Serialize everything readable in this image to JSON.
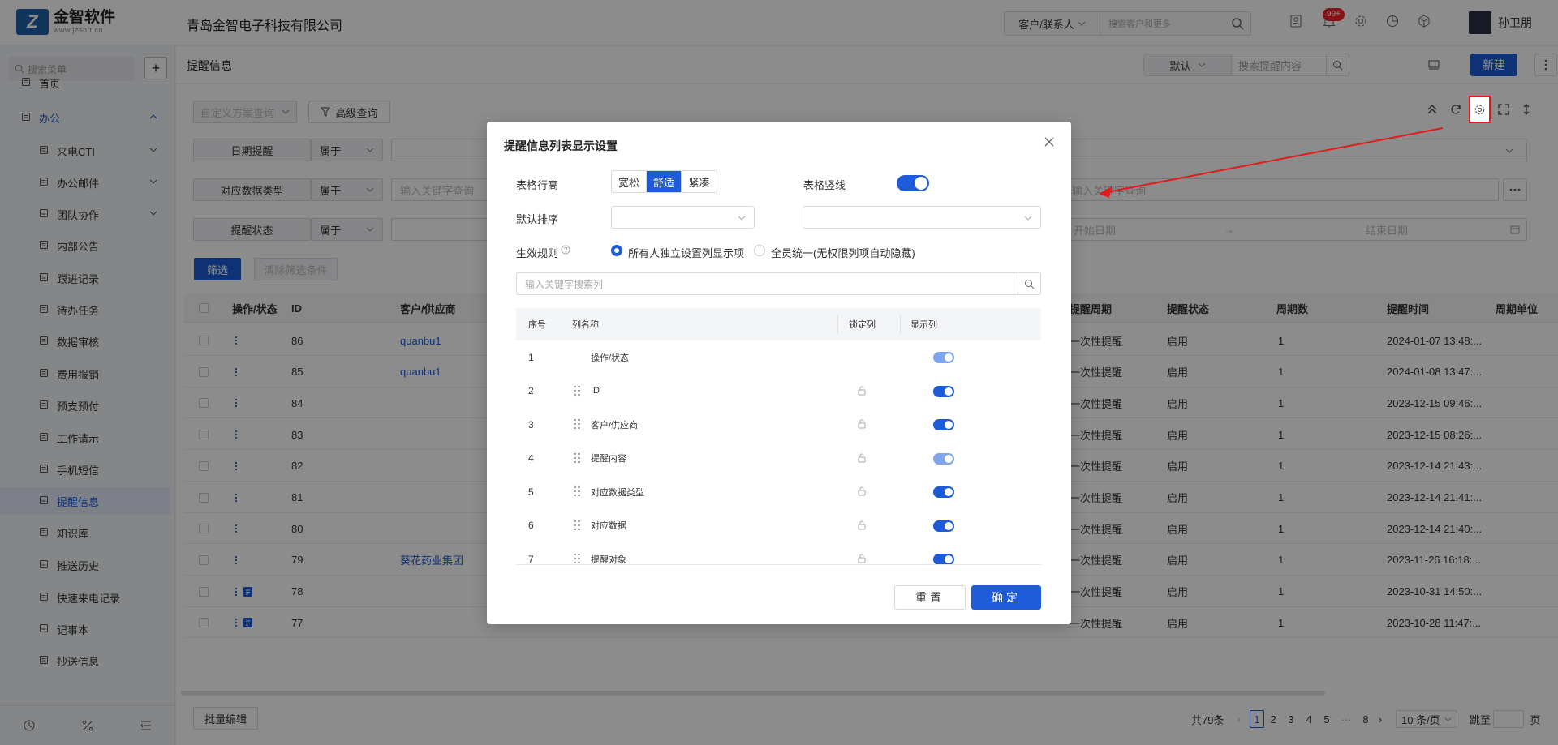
{
  "app": {
    "logo_text": "金智软件",
    "logo_url_text": "www.jzsoft.cn",
    "company": "青岛金智电子科技有限公司"
  },
  "header": {
    "search_scope": "客户/联系人",
    "search_placeholder": "搜索客户和更多",
    "notifications_badge": "99+",
    "user_name": "孙卫朋"
  },
  "sidebar": {
    "search_placeholder": "搜索菜单",
    "items": [
      {
        "label": "首页",
        "icon": "home-icon",
        "level": "top"
      },
      {
        "label": "办公",
        "icon": "office-icon",
        "level": "top",
        "expanded": true
      },
      {
        "label": "来电CTI",
        "icon": "copy-icon",
        "level": "sub",
        "has_children": true
      },
      {
        "label": "办公邮件",
        "icon": "copy-icon",
        "level": "sub",
        "has_children": true
      },
      {
        "label": "团队协作",
        "icon": "copy-icon",
        "level": "sub",
        "has_children": true
      },
      {
        "label": "内部公告",
        "icon": "speaker-icon",
        "level": "sub"
      },
      {
        "label": "跟进记录",
        "icon": "document-icon",
        "level": "sub"
      },
      {
        "label": "待办任务",
        "icon": "pin-icon",
        "level": "sub"
      },
      {
        "label": "数据审核",
        "icon": "user-icon",
        "level": "sub"
      },
      {
        "label": "费用报销",
        "icon": "receipt-icon",
        "level": "sub"
      },
      {
        "label": "预支预付",
        "icon": "card-icon",
        "level": "sub"
      },
      {
        "label": "工作请示",
        "icon": "form-icon",
        "level": "sub"
      },
      {
        "label": "手机短信",
        "icon": "chat-icon",
        "level": "sub"
      },
      {
        "label": "提醒信息",
        "icon": "bell-icon",
        "level": "sub",
        "active": true
      },
      {
        "label": "知识库",
        "icon": "book-icon",
        "level": "sub"
      },
      {
        "label": "推送历史",
        "icon": "clock-icon",
        "level": "sub"
      },
      {
        "label": "快速来电记录",
        "icon": "document-icon",
        "level": "sub"
      },
      {
        "label": "记事本",
        "icon": "notebook-icon",
        "level": "sub"
      },
      {
        "label": "抄送信息",
        "icon": "send-icon",
        "level": "sub"
      }
    ]
  },
  "page": {
    "title": "提醒信息",
    "scope_select": "默认",
    "search_placeholder": "搜索提醒内容",
    "new_button": "新建"
  },
  "filters": {
    "custom_scheme_placeholder": "自定义方案查询",
    "advanced_query": "高级查询",
    "rows": [
      {
        "field": "日期提醒",
        "op": "属于"
      },
      {
        "field": "对应数据类型",
        "op": "属于",
        "placeholder": "输入关键字查询"
      },
      {
        "field": "提醒状态",
        "op": "属于"
      }
    ],
    "right_keyword_placeholder": "输入关键字查询",
    "start_date": "开始日期",
    "range_arrow": "→",
    "end_date": "结束日期",
    "filter_button": "筛选",
    "clear_button": "清除筛选条件"
  },
  "table": {
    "headers_left": [
      "操作/状态",
      "ID",
      "客户/供应商"
    ],
    "headers_right": [
      "提醒周期",
      "提醒状态",
      "周期数",
      "提醒时间",
      "周期单位"
    ],
    "rows": [
      {
        "id": "86",
        "customer": "quanbu1",
        "period": "一次性提醒",
        "status": "启用",
        "count": "1",
        "time": "2024-01-07 13:48:...",
        "doc": false
      },
      {
        "id": "85",
        "customer": "quanbu1",
        "period": "一次性提醒",
        "status": "启用",
        "count": "1",
        "time": "2024-01-08 13:47:...",
        "doc": false
      },
      {
        "id": "84",
        "customer": "",
        "period": "一次性提醒",
        "status": "启用",
        "count": "1",
        "time": "2023-12-15 09:46:...",
        "doc": false
      },
      {
        "id": "83",
        "customer": "",
        "period": "一次性提醒",
        "status": "启用",
        "count": "1",
        "time": "2023-12-15 08:26:...",
        "doc": false
      },
      {
        "id": "82",
        "customer": "",
        "period": "一次性提醒",
        "status": "启用",
        "count": "1",
        "time": "2023-12-14 21:43:...",
        "doc": false
      },
      {
        "id": "81",
        "customer": "",
        "period": "一次性提醒",
        "status": "启用",
        "count": "1",
        "time": "2023-12-14 21:41:...",
        "doc": false
      },
      {
        "id": "80",
        "customer": "",
        "period": "一次性提醒",
        "status": "启用",
        "count": "1",
        "time": "2023-12-14 21:40:...",
        "doc": false
      },
      {
        "id": "79",
        "customer": "葵花药业集团",
        "period": "一次性提醒",
        "status": "启用",
        "count": "1",
        "time": "2023-11-26 16:18:...",
        "doc": false
      },
      {
        "id": "78",
        "customer": "",
        "period": "一次性提醒",
        "status": "启用",
        "count": "1",
        "time": "2023-10-31 14:50:...",
        "doc": true
      },
      {
        "id": "77",
        "customer": "",
        "period": "一次性提醒",
        "status": "启用",
        "count": "1",
        "time": "2023-10-28 11:47:...",
        "doc": true
      }
    ]
  },
  "footer": {
    "batch_edit": "批量编辑",
    "total": "共79条",
    "pages": [
      "1",
      "2",
      "3",
      "4",
      "5",
      "···",
      "8"
    ],
    "current_page": "1",
    "page_size": "10 条/页",
    "jump_label": "跳至",
    "page_unit": "页"
  },
  "modal": {
    "title": "提醒信息列表显示设置",
    "row_height_label": "表格行高",
    "row_height_options": [
      "宽松",
      "舒适",
      "紧凑"
    ],
    "row_height_selected": "舒适",
    "vertical_lines_label": "表格竖线",
    "vertical_lines_on": true,
    "default_sort_label": "默认排序",
    "rule_label": "生效规则",
    "rule_options": [
      "所有人独立设置列显示项",
      "全员统一(无权限列项自动隐藏)"
    ],
    "rule_selected": "所有人独立设置列显示项",
    "column_search_placeholder": "输入关键字搜索列",
    "col_headers": [
      "序号",
      "列名称",
      "锁定列",
      "显示列"
    ],
    "columns": [
      {
        "no": "1",
        "name": "操作/状态",
        "locked_icon": false,
        "shown": true,
        "disabled": true
      },
      {
        "no": "2",
        "name": "ID",
        "locked_icon": true,
        "shown": true,
        "disabled": false
      },
      {
        "no": "3",
        "name": "客户/供应商",
        "locked_icon": true,
        "shown": true,
        "disabled": false
      },
      {
        "no": "4",
        "name": "提醒内容",
        "locked_icon": true,
        "shown": true,
        "disabled": true
      },
      {
        "no": "5",
        "name": "对应数据类型",
        "locked_icon": true,
        "shown": true,
        "disabled": false
      },
      {
        "no": "6",
        "name": "对应数据",
        "locked_icon": true,
        "shown": true,
        "disabled": false
      },
      {
        "no": "7",
        "name": "提醒对象",
        "locked_icon": true,
        "shown": true,
        "disabled": false
      }
    ],
    "reset_button": "重置",
    "ok_button": "确定"
  },
  "colors": {
    "primary": "#1d5bd8",
    "annotation": "#e21b1b",
    "mask": "rgba(0,0,0,0.45)"
  }
}
